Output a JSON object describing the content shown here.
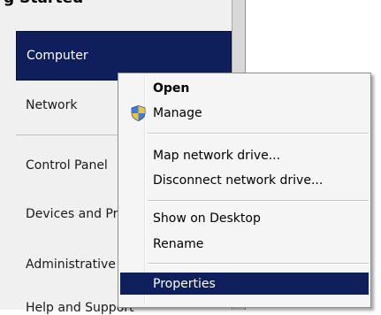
{
  "start_pane": {
    "top_partial": "g Started",
    "items": [
      {
        "label": "Computer"
      },
      {
        "label": "Network"
      },
      {
        "label": "Control Panel"
      },
      {
        "label": "Devices and Printers"
      },
      {
        "label": "Administrative Tools"
      }
    ],
    "bottom_partial": "Help and Support"
  },
  "context_menu": {
    "open_label": "Open",
    "manage_label": "Manage",
    "map_drive_label": "Map network drive...",
    "disconnect_drive_label": "Disconnect network drive...",
    "show_desktop_label": "Show on Desktop",
    "rename_label": "Rename",
    "properties_label": "Properties"
  },
  "colors": {
    "selection": "#0e1f5c",
    "menu_background": "#f5f5f5"
  },
  "icons": {
    "manage": "uac-shield-icon"
  }
}
